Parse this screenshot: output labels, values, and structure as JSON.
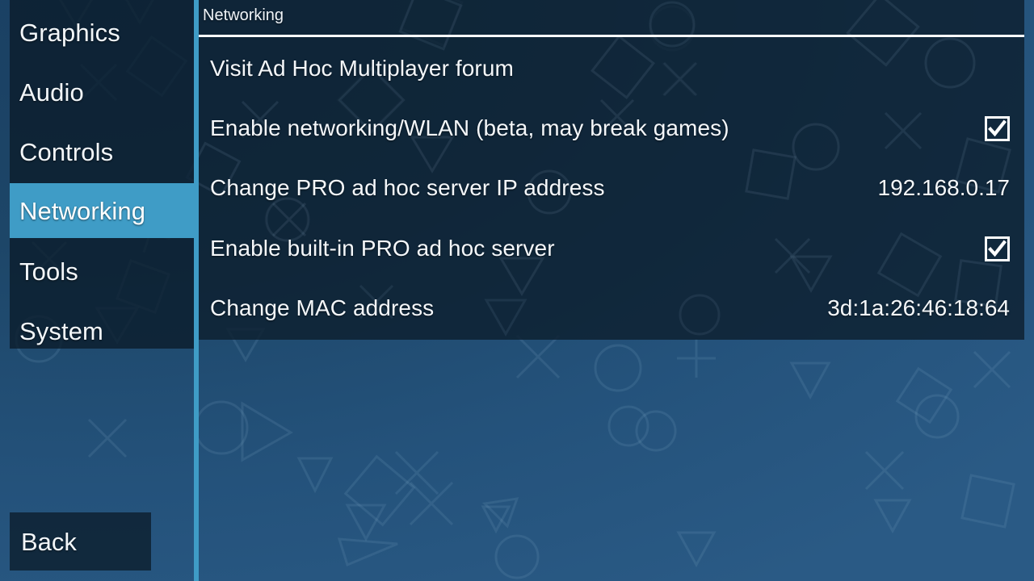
{
  "window": {
    "app": "PPSSPP Settings",
    "accent_color": "#3f9cc6",
    "panel_color": "#0c1e2d",
    "background_color": "#1d4668",
    "text_color": "#f4f7fa"
  },
  "sidebar": {
    "items": [
      {
        "label": "Graphics",
        "selected": false
      },
      {
        "label": "Audio",
        "selected": false
      },
      {
        "label": "Controls",
        "selected": false
      },
      {
        "label": "Networking",
        "selected": true
      },
      {
        "label": "Tools",
        "selected": false
      },
      {
        "label": "System",
        "selected": false
      }
    ],
    "back_label": "Back"
  },
  "panel": {
    "title": "Networking",
    "rows": [
      {
        "label": "Visit Ad Hoc Multiplayer forum",
        "kind": "link",
        "value": "",
        "checked": false
      },
      {
        "label": "Enable networking/WLAN (beta, may break games)",
        "kind": "checkbox",
        "value": "",
        "checked": true
      },
      {
        "label": "Change PRO ad hoc server IP address",
        "kind": "value",
        "value": "192.168.0.17",
        "checked": false
      },
      {
        "label": "Enable built-in PRO ad hoc server",
        "kind": "checkbox",
        "value": "",
        "checked": true
      },
      {
        "label": "Change MAC address",
        "kind": "value",
        "value": "3d:1a:26:46:18:64",
        "checked": false
      }
    ]
  }
}
